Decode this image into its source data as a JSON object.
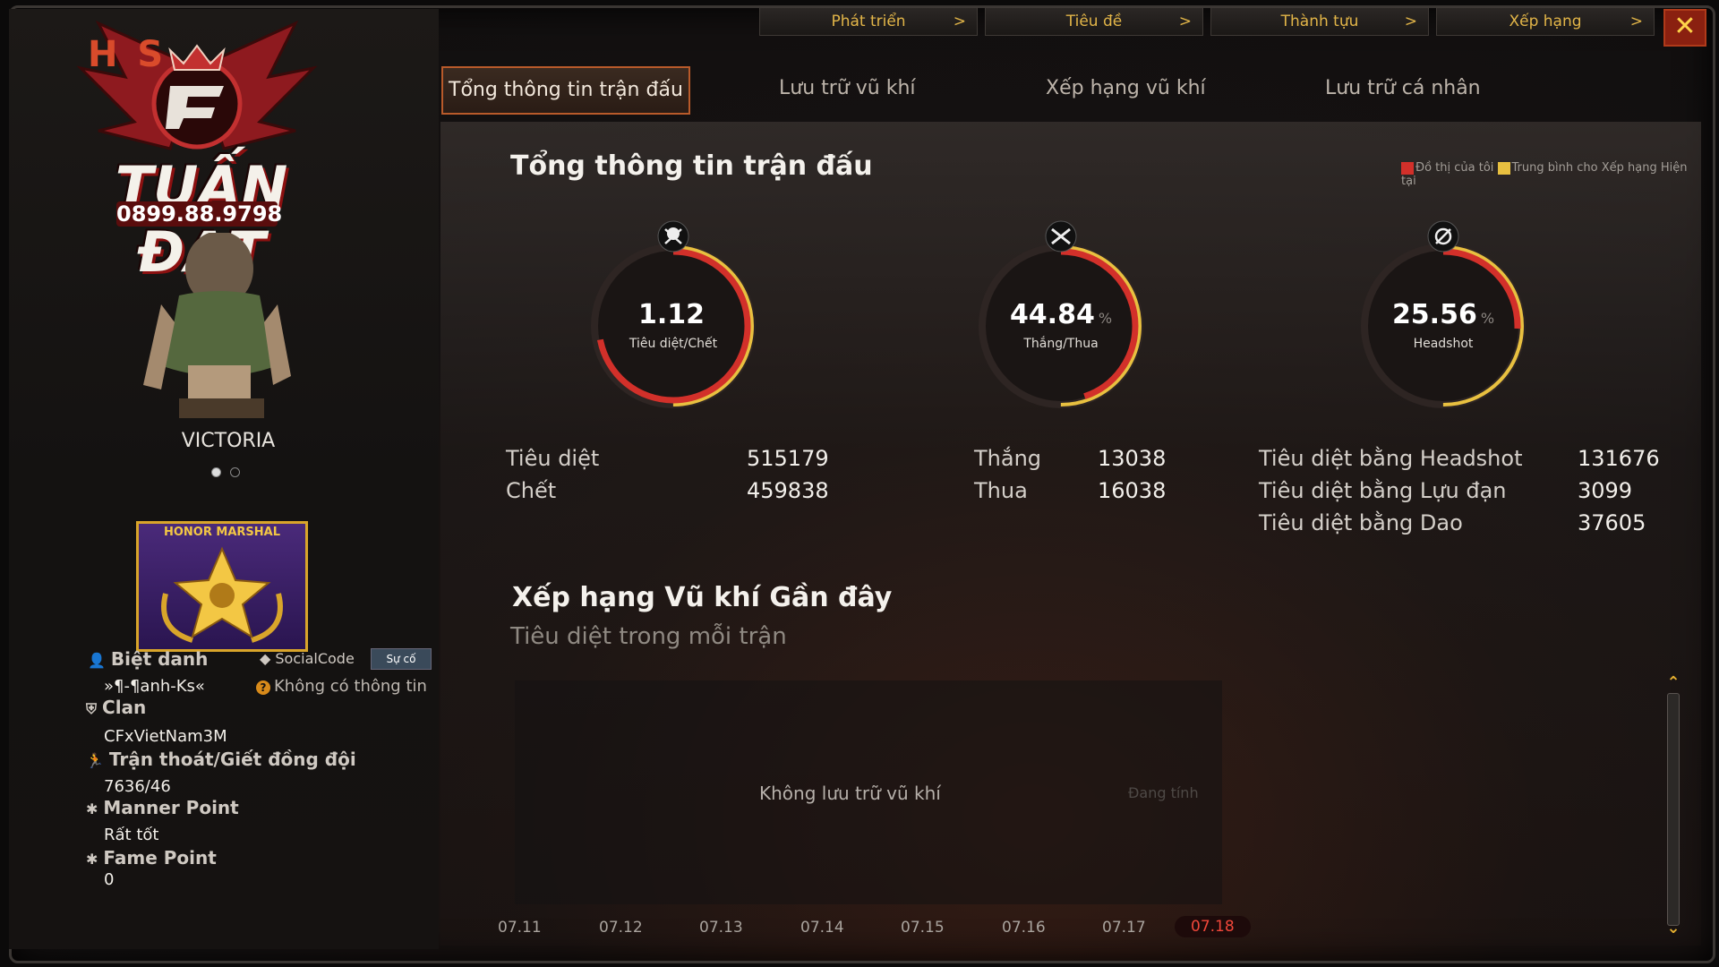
{
  "top_menu": [
    {
      "label": "Phát triển"
    },
    {
      "label": "Tiêu đề"
    },
    {
      "label": "Thành tựu"
    },
    {
      "label": "Xếp hạng"
    }
  ],
  "close_label": "✕",
  "tabs": [
    {
      "label": "Tổng thông tin trận đấu",
      "active": true
    },
    {
      "label": "Lưu trữ vũ khí"
    },
    {
      "label": "Xếp hạng vũ khí"
    },
    {
      "label": "Lưu trữ cá nhân"
    }
  ],
  "logo": {
    "text": "TUẤN ĐẠT",
    "hks": "H S",
    "phone": "0899.88.9798"
  },
  "character": {
    "name": "VICTORIA"
  },
  "badge": {
    "title": "HONOR MARSHAL"
  },
  "profile": {
    "nickname_label": "Biệt danh",
    "nickname": "»¶-¶anh-Ks«",
    "social_label": "SocialCode",
    "social_button": "Sự cố",
    "no_info": "Không có thông tin",
    "clan_label": "Clan",
    "clan": "CFxVietNam3M",
    "escape_label": "Trận thoát/Giết đồng đội",
    "escape": "7636/46",
    "manner_label": "Manner Point",
    "manner": "Rất tốt",
    "fame_label": "Fame Point",
    "fame": "0"
  },
  "main": {
    "title": "Tổng thông tin trận đấu",
    "legend_mine": "Đồ thị của tôi",
    "legend_avg": "Trung bình cho Xếp hạng Hiện tại",
    "gauges": [
      {
        "value": "1.12",
        "label": "Tiêu diệt/Chết",
        "pct": "",
        "fraction": 0.72
      },
      {
        "value": "44.84",
        "label": "Thắng/Thua",
        "pct": "%",
        "fraction": 0.4484
      },
      {
        "value": "25.56",
        "label": "Headshot",
        "pct": "%",
        "fraction": 0.2556
      }
    ],
    "stats": {
      "kills_label": "Tiêu diệt",
      "kills": "515179",
      "deaths_label": "Chết",
      "deaths": "459838",
      "wins_label": "Thắng",
      "wins": "13038",
      "losses_label": "Thua",
      "losses": "16038",
      "hs_label": "Tiêu diệt bằng Headshot",
      "hs": "131676",
      "grenade_label": "Tiêu diệt bằng Lựu đạn",
      "grenade": "3099",
      "knife_label": "Tiêu diệt bằng Dao",
      "knife": "37605"
    },
    "weapon_title": "Xếp hạng Vũ khí Gần đây",
    "weapon_sub": "Tiêu diệt trong mỗi trận",
    "empty_text": "Không lưu trữ vũ khí",
    "calc_text": "Đang tính",
    "x_ticks": [
      "07.11",
      "07.12",
      "07.13",
      "07.14",
      "07.15",
      "07.16",
      "07.17",
      "07.18"
    ],
    "selected_tick": "07.18"
  },
  "colors": {
    "accent_gold": "#e2b548",
    "accent_red": "#d2302a",
    "track_yellow": "#e8c040"
  }
}
